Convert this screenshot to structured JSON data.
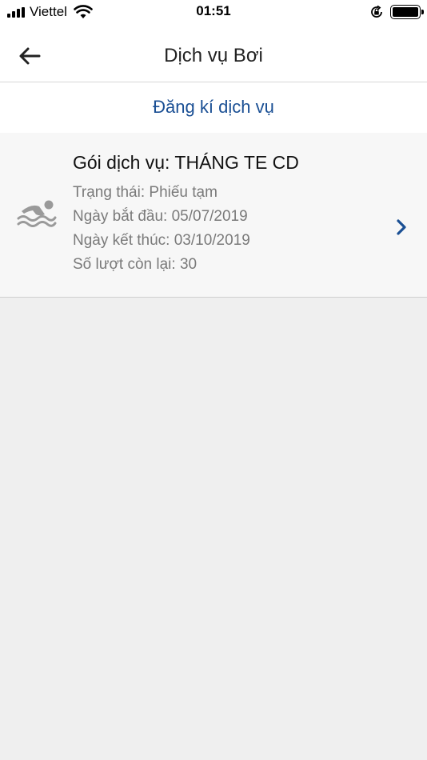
{
  "status_bar": {
    "carrier": "Viettel",
    "time": "01:51"
  },
  "nav": {
    "title": "Dịch vụ Bơi"
  },
  "register": {
    "label": "Đăng kí dịch vụ"
  },
  "service_card": {
    "package": "Gói dịch vụ: THÁNG TE CD",
    "status": "Trạng thái: Phiếu tạm",
    "start_date": "Ngày bắt đầu: 05/07/2019",
    "end_date": "Ngày kết thúc: 03/10/2019",
    "remaining": "Số lượt còn lại: 30"
  },
  "colors": {
    "accent": "#1a4f94",
    "background": "#efefef",
    "card": "#f7f7f7",
    "secondary_text": "#7a7a7a"
  },
  "icons": [
    "signal-icon",
    "wifi-icon",
    "rotation-lock-icon",
    "battery-icon",
    "back-arrow-icon",
    "swimmer-icon",
    "chevron-right-icon"
  ]
}
